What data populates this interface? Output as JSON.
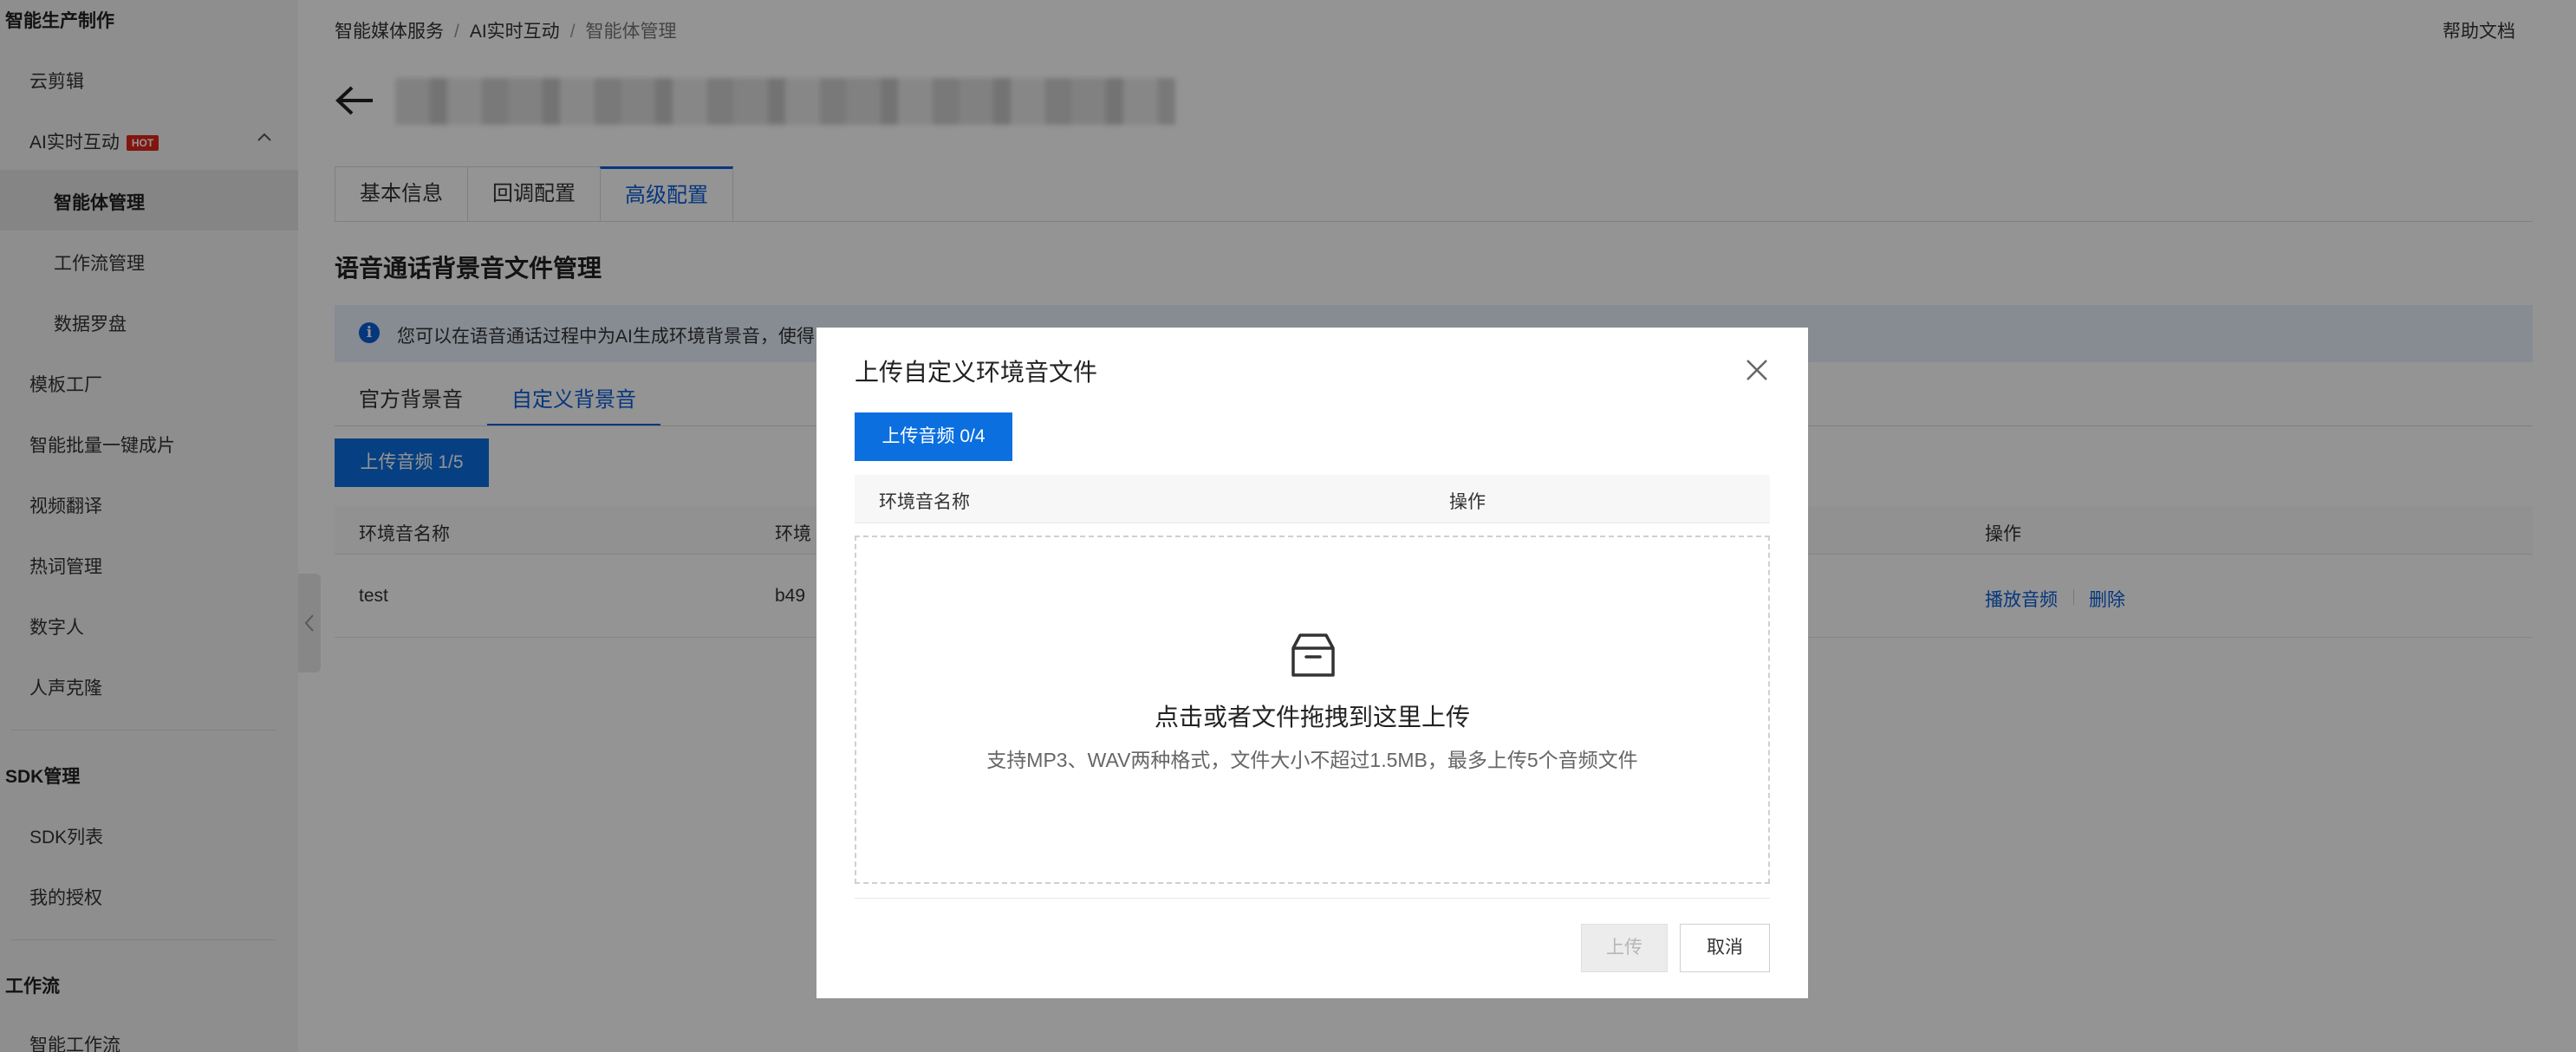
{
  "sidebar": {
    "section_production": "智能生产制作",
    "items": [
      "云剪辑",
      "AI实时互动",
      "智能体管理",
      "工作流管理",
      "数据罗盘",
      "模板工厂",
      "智能批量一键成片",
      "视频翻译",
      "热词管理",
      "数字人",
      "人声克隆"
    ],
    "hot_badge": "HOT",
    "section_sdk": "SDK管理",
    "sdk_items": [
      "SDK列表",
      "我的授权"
    ],
    "section_workflow": "工作流",
    "workflow_items": [
      "智能工作流"
    ]
  },
  "header": {
    "breadcrumb": [
      "智能媒体服务",
      "AI实时互动",
      "智能体管理"
    ],
    "help": "帮助文档"
  },
  "tabs": [
    "基本信息",
    "回调配置",
    "高级配置"
  ],
  "section_title": "语音通话背景音文件管理",
  "info_text": "您可以在语音通话过程中为AI生成环境背景音，使得",
  "subtabs": [
    "官方背景音",
    "自定义背景音"
  ],
  "upload_button": "上传音频 1/5",
  "table": {
    "headers": [
      "环境音名称",
      "环境",
      "操作"
    ],
    "rows": [
      {
        "name": "test",
        "id": "b49",
        "actions": [
          "播放音频",
          "删除"
        ]
      }
    ]
  },
  "modal": {
    "title": "上传自定义环境音文件",
    "upload_button": "上传音频 0/4",
    "headers": [
      "环境音名称",
      "操作"
    ],
    "dropzone_title": "点击或者文件拖拽到这里上传",
    "dropzone_hint": "支持MP3、WAV两种格式，文件大小不超过1.5MB，最多上传5个音频文件",
    "confirm": "上传",
    "cancel": "取消"
  },
  "colors": {
    "accent": "#0b6fe0",
    "link": "#0b5dd7",
    "hot": "#e1251b"
  }
}
